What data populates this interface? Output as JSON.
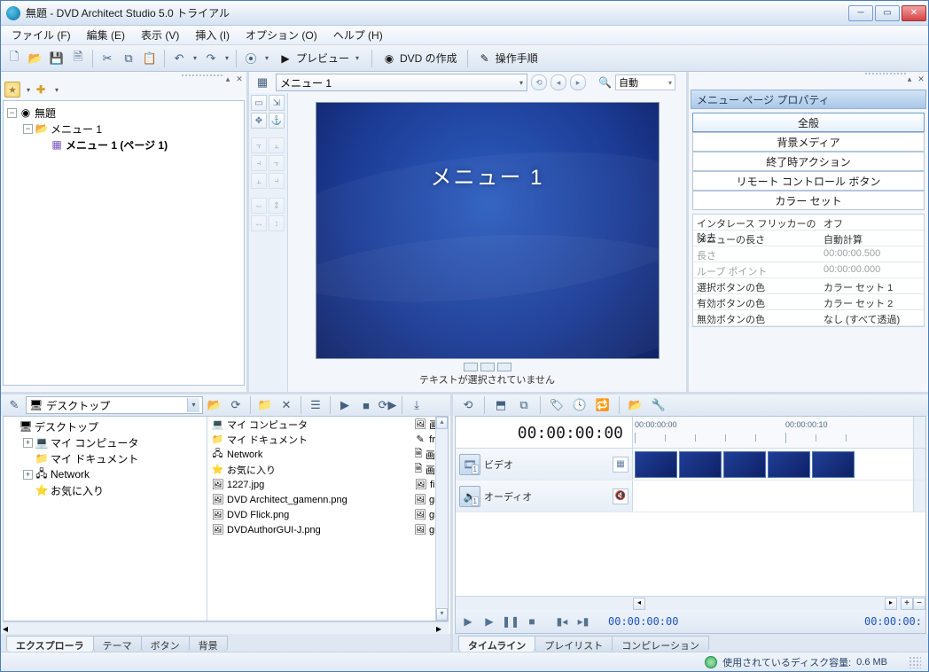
{
  "title": "無題 - DVD Architect Studio 5.0 トライアル",
  "menubar": [
    "ファイル (F)",
    "編集 (E)",
    "表示 (V)",
    "挿入 (I)",
    "オプション (O)",
    "ヘルプ (H)"
  ],
  "toolbar": {
    "preview_label": "プレビュー",
    "make_dvd_label": "DVD の作成",
    "guide_label": "操作手順"
  },
  "tree": {
    "root": "無題",
    "menu1": "メニュー 1",
    "page1": "メニュー 1 (ページ 1)"
  },
  "preview": {
    "crumb": "メニュー 1",
    "zoom": "自動",
    "slide_title": "メニュー 1",
    "status": "テキストが選択されていません"
  },
  "props": {
    "header": "メニュー ページ プロパティ",
    "tabs": [
      "全般",
      "背景メディア",
      "終了時アクション",
      "リモート コントロール ボタン",
      "カラー セット"
    ],
    "rows": [
      {
        "k": "インタレース フリッカーの除去",
        "v": "オフ"
      },
      {
        "k": "メニューの長さ",
        "v": "自動計算"
      },
      {
        "k": "長さ",
        "v": "00:00:00.500",
        "dis": true,
        "tm": true
      },
      {
        "k": "ループ ポイント",
        "v": "00:00:00.000",
        "dis": true,
        "tm": true
      },
      {
        "k": "選択ボタンの色",
        "v": "カラー セット 1"
      },
      {
        "k": "有効ボタンの色",
        "v": "カラー セット 2"
      },
      {
        "k": "無効ボタンの色",
        "v": "なし (すべて透過)"
      }
    ]
  },
  "explorer": {
    "combo": "デスクトップ",
    "tree": [
      {
        "label": "デスクトップ",
        "depth": 0,
        "icon": "desk"
      },
      {
        "label": "マイ コンピュータ",
        "depth": 1,
        "icon": "comp",
        "tw": "+"
      },
      {
        "label": "マイ ドキュメント",
        "depth": 1,
        "icon": "doc"
      },
      {
        "label": "Network",
        "depth": 1,
        "icon": "net",
        "tw": "+"
      },
      {
        "label": "お気に入り",
        "depth": 1,
        "icon": "fav"
      }
    ],
    "files_left": [
      {
        "label": "マイ コンピュータ",
        "icon": "comp"
      },
      {
        "label": "マイ ドキュメント",
        "icon": "doc"
      },
      {
        "label": "Network",
        "icon": "net"
      },
      {
        "label": "お気に入り",
        "icon": "fav"
      },
      {
        "label": "1227.jpg",
        "icon": "img"
      },
      {
        "label": "DVD Architect_gamenn.png",
        "icon": "img"
      },
      {
        "label": "DVD Flick.png",
        "icon": "img"
      },
      {
        "label": "DVDAuthorGUI-J.png",
        "icon": "img"
      }
    ],
    "tabs": [
      "エクスプローラ",
      "テーマ",
      "ボタン",
      "背景"
    ]
  },
  "timeline": {
    "clock": "00:00:00:00",
    "ruler_labels": [
      "00:00:00:00",
      "00:00:00:10"
    ],
    "tracks": [
      {
        "name": "ビデオ",
        "icon": "film"
      },
      {
        "name": "オーディオ",
        "icon": "spk"
      }
    ],
    "pos": "00:00:00:00",
    "dur": "00:00:00:",
    "tabs": [
      "タイムライン",
      "プレイリスト",
      "コンピレーション"
    ]
  },
  "status": {
    "disk_label": "使用されているディスク容量:",
    "disk_value": "0.6 MB"
  }
}
